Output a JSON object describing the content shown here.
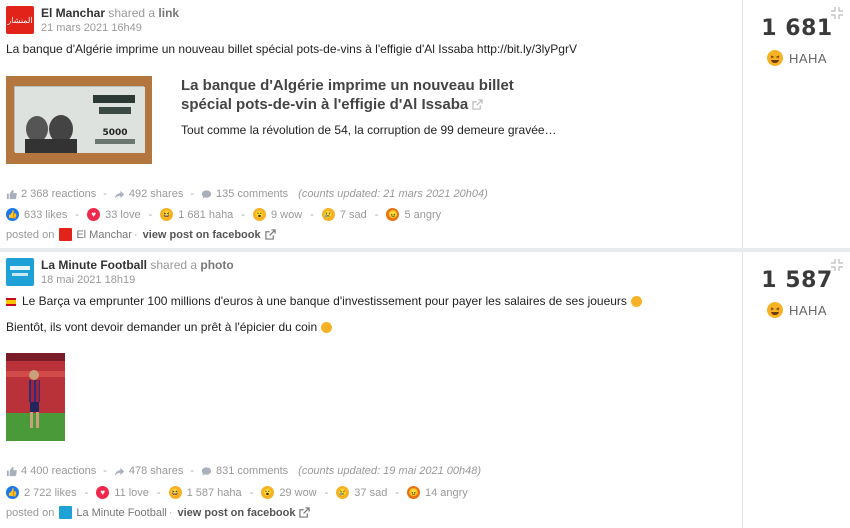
{
  "posts": [
    {
      "author": "El Manchar",
      "avatar_text": "المنشار",
      "shared_text": "shared a",
      "shared_type": "link",
      "date": "21 mars 2021 16h49",
      "message": "La banque d'Algérie imprime un nouveau billet spécial pots-de-vins à l'effigie d'Al Issaba http://bit.ly/3lyPgrV",
      "link_title": "La banque d'Algérie imprime un nouveau billet spécial pots-de-vin à l'effigie d'Al Issaba",
      "link_description": "Tout comme la révolution de 54, la corruption de 99 demeure gravée…",
      "reactions_count": "2 368 reactions",
      "shares_count": "492 shares",
      "comments_count": "135 comments",
      "counts_updated": "(counts updated: 21 mars 2021 20h04)",
      "likes": "633 likes",
      "love": "33 love",
      "haha": "1 681 haha",
      "wow": "9 wow",
      "sad": "7 sad",
      "angry": "5 angry",
      "posted_on": "posted on",
      "page_name": "El Manchar",
      "view_post": "view post on facebook",
      "big_count": "1 681",
      "big_label": "HAHA"
    },
    {
      "author": "La Minute Football",
      "shared_text": "shared a",
      "shared_type": "photo",
      "date": "18 mai 2021 18h19",
      "message": "Le Barça va emprunter 100 millions d'euros à une banque d'investissement pour payer les salaires de ses joueurs",
      "message2": "Bientôt, ils vont devoir demander un prêt à l'épicier du coin",
      "reactions_count": "4 400 reactions",
      "shares_count": "478 shares",
      "comments_count": "831 comments",
      "counts_updated": "(counts updated: 19 mai 2021 00h48)",
      "likes": "2 722 likes",
      "love": "11 love",
      "haha": "1 587 haha",
      "wow": "29 wow",
      "sad": "37 sad",
      "angry": "14 angry",
      "posted_on": "posted on",
      "page_name": "La Minute Football",
      "view_post": "view post on facebook",
      "big_count": "1 587",
      "big_label": "HAHA"
    }
  ],
  "icons": {
    "like": "thumbs-up-icon",
    "share": "share-icon",
    "comment": "comment-icon",
    "external": "external-link-icon",
    "compress": "compress-icon"
  }
}
